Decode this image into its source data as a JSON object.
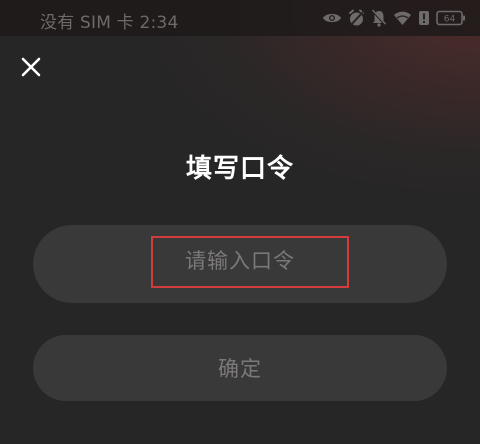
{
  "status_bar": {
    "text": "没有 SIM 卡 2:34",
    "battery_level": "64",
    "icons": [
      "eye-icon",
      "alarm-off-icon",
      "bell-off-icon",
      "wifi-icon",
      "alert-icon",
      "battery-icon"
    ]
  },
  "dialog": {
    "title": "填写口令",
    "input_placeholder": "请输入口令",
    "input_value": "",
    "confirm_label": "确定",
    "close_icon": "close-icon"
  },
  "colors": {
    "background": "#262626",
    "pill": "#3a3939",
    "placeholder_text": "#7b7878",
    "highlight_border": "#d33c3c",
    "status_text": "#6e6a6a"
  }
}
